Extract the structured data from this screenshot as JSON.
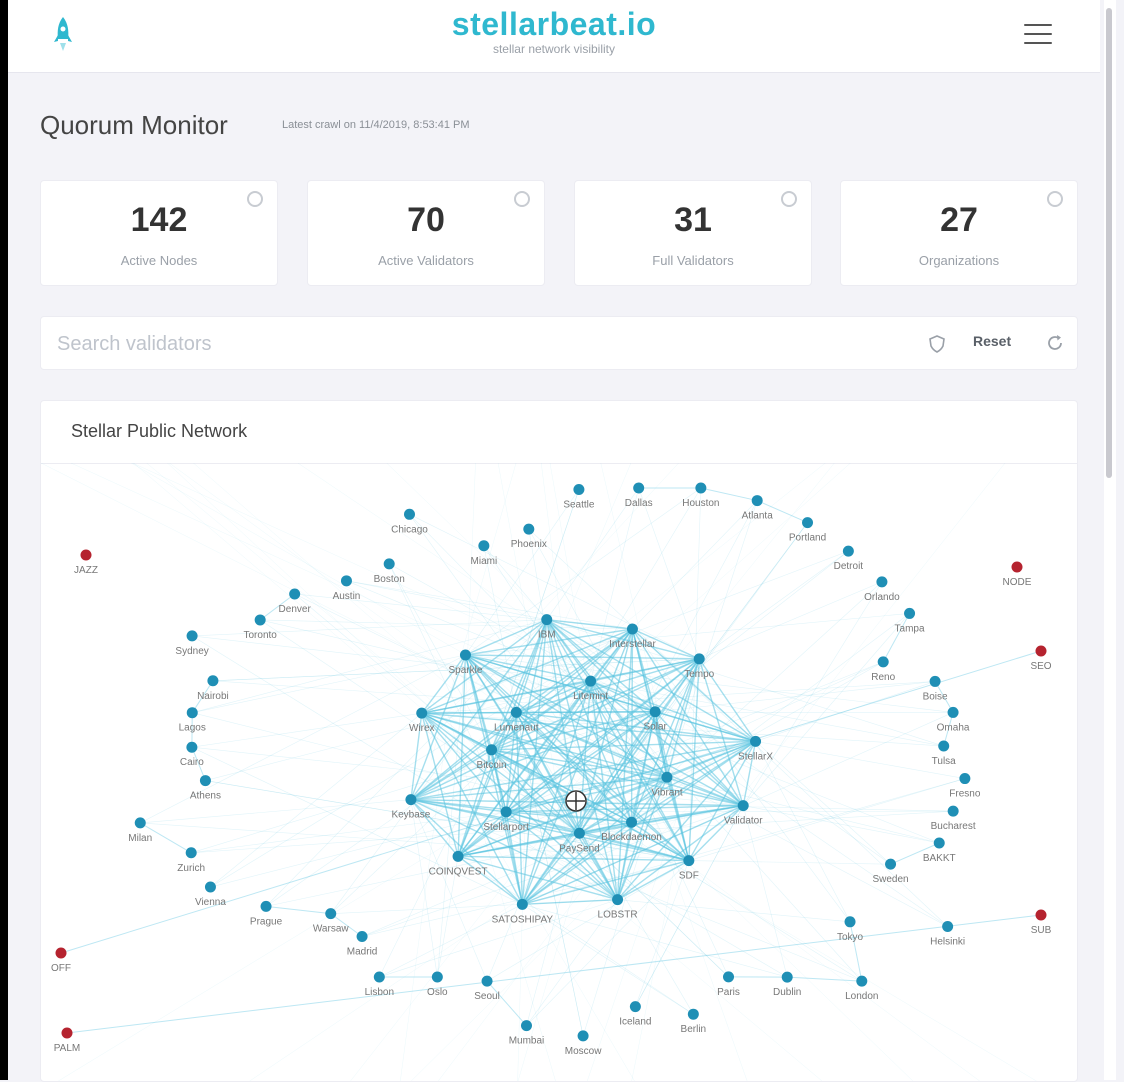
{
  "header": {
    "brand_title": "stellarbeat.io",
    "brand_subtitle": "stellar network visibility",
    "accent_color": "#2fb8cf",
    "logo_icon": "rocket-icon",
    "menu_icon": "hamburger-menu-icon"
  },
  "page": {
    "title": "Quorum Monitor",
    "updated": "Latest crawl on 11/4/2019, 8:53:41 PM"
  },
  "stats": [
    {
      "value": "142",
      "label": "Active Nodes"
    },
    {
      "value": "70",
      "label": "Active Validators"
    },
    {
      "value": "31",
      "label": "Full Validators"
    },
    {
      "value": "27",
      "label": "Organizations"
    }
  ],
  "search": {
    "placeholder": "Search validators",
    "reset_label": "Reset"
  },
  "network": {
    "title": "Stellar Public Network",
    "node_color": "#1f8fb5",
    "failing_color": "#b5232f",
    "edge_color": "#5bc4e0",
    "nodes": [
      {
        "label": "Validator",
        "status": "active"
      },
      {
        "label": "SDF",
        "status": "active"
      },
      {
        "label": "LOBSTR",
        "status": "active"
      },
      {
        "label": "SATOSHIPAY",
        "status": "active"
      },
      {
        "label": "COINQVEST",
        "status": "active"
      },
      {
        "label": "Keybase",
        "status": "active"
      },
      {
        "label": "Wirex",
        "status": "active"
      },
      {
        "label": "Sparkle",
        "status": "active"
      },
      {
        "label": "IBM",
        "status": "active"
      },
      {
        "label": "Interstellar",
        "status": "active"
      },
      {
        "label": "Tempo",
        "status": "active"
      },
      {
        "label": "StellarX",
        "status": "active"
      },
      {
        "label": "Blockdaemon",
        "status": "active"
      },
      {
        "label": "PaySend",
        "status": "active"
      },
      {
        "label": "Stellarport",
        "status": "active"
      },
      {
        "label": "Bitcoin",
        "status": "active"
      },
      {
        "label": "Lumenaut",
        "status": "active"
      },
      {
        "label": "Litemint",
        "status": "active"
      },
      {
        "label": "Solar",
        "status": "active"
      },
      {
        "label": "Vibrant",
        "status": "active"
      },
      {
        "label": "Bucharest",
        "status": "active"
      },
      {
        "label": "BAKKT",
        "status": "active"
      },
      {
        "label": "Sweden",
        "status": "active"
      },
      {
        "label": "Helsinki",
        "status": "active"
      },
      {
        "label": "Tokyo",
        "status": "active"
      },
      {
        "label": "London",
        "status": "active"
      },
      {
        "label": "Dublin",
        "status": "active"
      },
      {
        "label": "Paris",
        "status": "active"
      },
      {
        "label": "Berlin",
        "status": "active"
      },
      {
        "label": "Iceland",
        "status": "active"
      },
      {
        "label": "Moscow",
        "status": "active"
      },
      {
        "label": "Mumbai",
        "status": "active"
      },
      {
        "label": "Seoul",
        "status": "active"
      },
      {
        "label": "Oslo",
        "status": "active"
      },
      {
        "label": "Lisbon",
        "status": "active"
      },
      {
        "label": "Madrid",
        "status": "active"
      },
      {
        "label": "Warsaw",
        "status": "active"
      },
      {
        "label": "Prague",
        "status": "active"
      },
      {
        "label": "Vienna",
        "status": "active"
      },
      {
        "label": "Zurich",
        "status": "active"
      },
      {
        "label": "Milan",
        "status": "active"
      },
      {
        "label": "Athens",
        "status": "active"
      },
      {
        "label": "Cairo",
        "status": "active"
      },
      {
        "label": "Lagos",
        "status": "active"
      },
      {
        "label": "Nairobi",
        "status": "active"
      },
      {
        "label": "Sydney",
        "status": "active"
      },
      {
        "label": "Toronto",
        "status": "active"
      },
      {
        "label": "Denver",
        "status": "active"
      },
      {
        "label": "Austin",
        "status": "active"
      },
      {
        "label": "Boston",
        "status": "active"
      },
      {
        "label": "Chicago",
        "status": "active"
      },
      {
        "label": "Miami",
        "status": "active"
      },
      {
        "label": "Phoenix",
        "status": "active"
      },
      {
        "label": "Seattle",
        "status": "active"
      },
      {
        "label": "Dallas",
        "status": "active"
      },
      {
        "label": "Houston",
        "status": "active"
      },
      {
        "label": "Atlanta",
        "status": "active"
      },
      {
        "label": "Portland",
        "status": "active"
      },
      {
        "label": "Detroit",
        "status": "active"
      },
      {
        "label": "Orlando",
        "status": "active"
      },
      {
        "label": "Tampa",
        "status": "active"
      },
      {
        "label": "Reno",
        "status": "active"
      },
      {
        "label": "Boise",
        "status": "active"
      },
      {
        "label": "Omaha",
        "status": "active"
      },
      {
        "label": "Tulsa",
        "status": "active"
      },
      {
        "label": "Fresno",
        "status": "active"
      },
      {
        "label": "JAZZ",
        "status": "failing"
      },
      {
        "label": "NODE",
        "status": "failing"
      },
      {
        "label": "SEO",
        "status": "failing"
      },
      {
        "label": "OFF",
        "status": "failing"
      },
      {
        "label": "SUB",
        "status": "failing"
      },
      {
        "label": "PALM",
        "status": "failing"
      }
    ]
  }
}
